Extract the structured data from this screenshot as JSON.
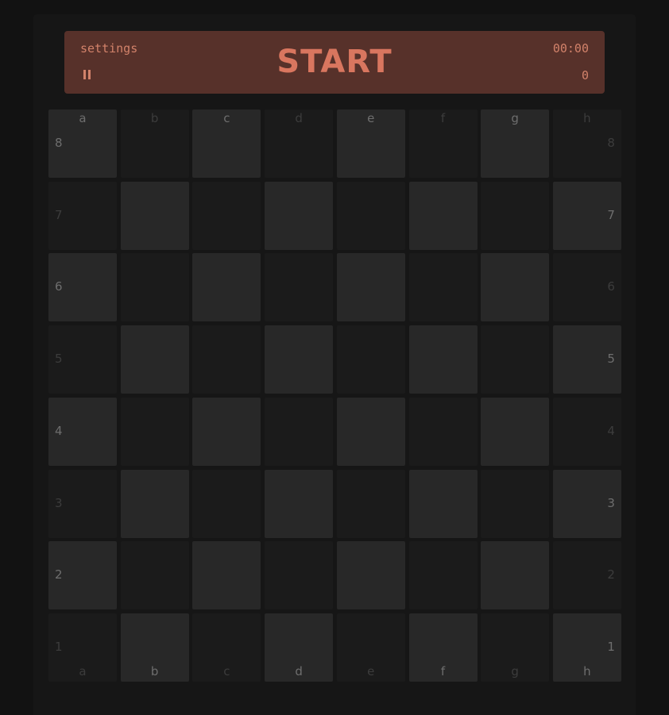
{
  "header": {
    "settings_label": "settings",
    "start_label": "START",
    "timer": "00:00",
    "counter": "0",
    "pause_icon": "pause-icon"
  },
  "board": {
    "files": [
      "a",
      "b",
      "c",
      "d",
      "e",
      "f",
      "g",
      "h"
    ],
    "ranks": [
      "8",
      "7",
      "6",
      "5",
      "4",
      "3",
      "2",
      "1"
    ]
  },
  "colors": {
    "background": "#121212",
    "panel": "#161616",
    "header_bg": "#57312a",
    "accent": "#d9765f",
    "light_square": "#282828",
    "dark_square": "#1b1b1b"
  }
}
